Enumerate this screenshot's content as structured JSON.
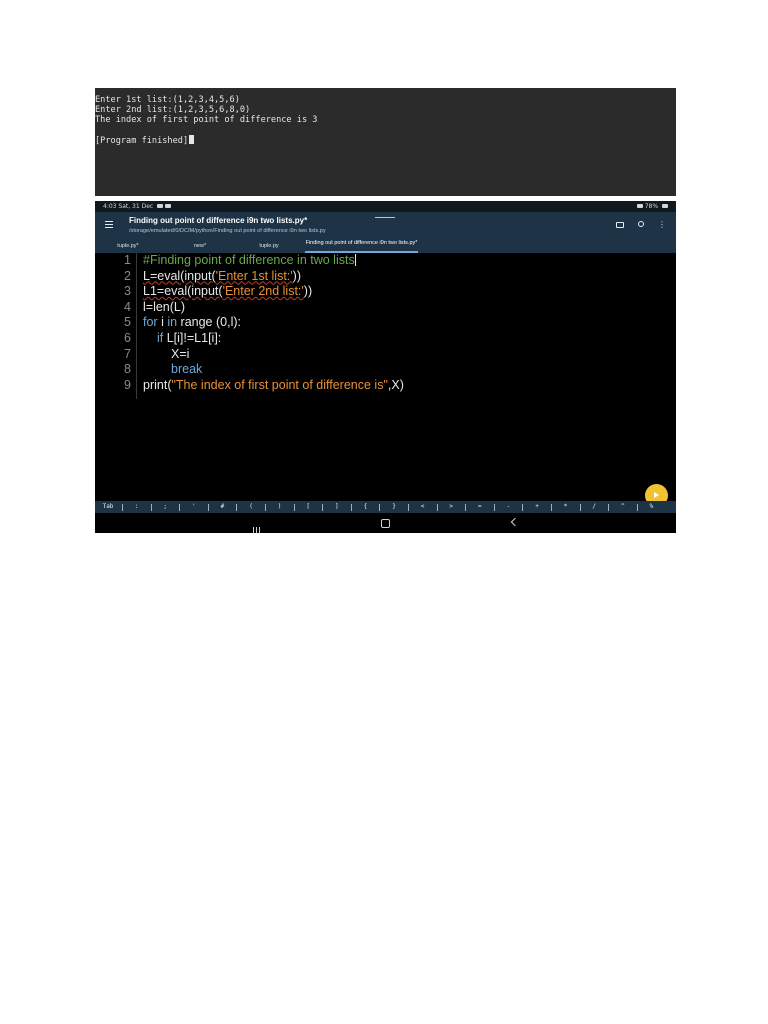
{
  "terminal": {
    "lines": [
      "Enter 1st list:(1,2,3,4,5,6)",
      "Enter 2nd list:(1,2,3,5,6,8,0)",
      "The index of first point of difference is 3",
      "[Program finished]"
    ]
  },
  "status_bar": {
    "time": "4:03",
    "date": "Sat, 31 Dec",
    "right": "78%"
  },
  "app_bar": {
    "title": "Finding out point of difference i9n two lists.py*",
    "path": "/storage/emulated/0/DCIM/python/Finding out point of difference i9n two lists.py"
  },
  "tabs": [
    {
      "label": "tuple.py*"
    },
    {
      "label": "new*"
    },
    {
      "label": "tuple.py"
    },
    {
      "label": "Finding out point of difference i9n two lists.py*"
    }
  ],
  "code": {
    "line_numbers": [
      "1",
      "2",
      "3",
      "4",
      "5",
      "6",
      "7",
      "8",
      "9"
    ],
    "l1_comment": "#Finding point of difference in two lists",
    "l2_a": "L=eval(input(",
    "l2_str": "'Enter 1st list:'",
    "l2_b": "))",
    "l3_a": "L1=eval(input(",
    "l3_str": "'Enter 2nd list:'",
    "l3_b": "))",
    "l4": "l=len(L)",
    "l5_kw1": "for",
    "l5_a": " i ",
    "l5_kw2": "in",
    "l5_b": " range (0,l):",
    "l6_kw": "if",
    "l6_a": " L[i]!=L1[i]:",
    "l7": "X=i",
    "l8_kw": "break",
    "l9_a": "print(",
    "l9_str": "\"The index of first point of difference is\"",
    "l9_b": ",X)"
  },
  "keybar": {
    "keys": [
      "Tab",
      ":",
      ";",
      "'",
      "#",
      "(",
      ")",
      "[",
      "]",
      "{",
      "}",
      "<",
      ">",
      "=",
      "-",
      "+",
      "*",
      "/",
      "^",
      "%"
    ]
  },
  "colors": {
    "appbar": "#1e3346",
    "comment": "#6aa84f",
    "string": "#e69138",
    "keyword": "#6fa8dc",
    "fab": "#f1c232"
  }
}
